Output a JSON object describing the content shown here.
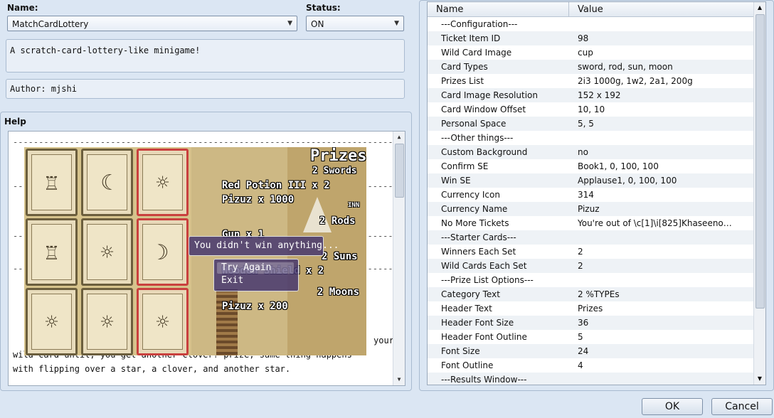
{
  "plugin": {
    "name_label": "Name:",
    "name_value": "MatchCardLottery",
    "status_label": "Status:",
    "status_value": "ON",
    "description": "A scratch-card-lottery-like minigame!",
    "author": "Author: mjshi"
  },
  "help": {
    "title": "Help",
    "text_lines": [
      "your",
      "wild card until, you get another clover? prize, same thing happens",
      "with flipping over a star, a clover, and another star."
    ],
    "game": {
      "prizes_title": "Prizes",
      "prizes": [
        "2 Swords",
        "Red Potion III x 2",
        "Pizuz x 1000",
        "2 Rods",
        "Gun x 1",
        "2 Suns",
        "Wooden Shield x 2",
        "2 Moons",
        "Pizuz x 200"
      ],
      "inn_sign": "INN",
      "message": "You didn't win anything...",
      "choices": [
        "Try Again",
        "Exit"
      ]
    }
  },
  "table": {
    "col_name": "Name",
    "col_value": "Value",
    "rows": [
      {
        "name": "---Configuration---",
        "value": ""
      },
      {
        "name": "Ticket Item ID",
        "value": "98"
      },
      {
        "name": "Wild Card Image",
        "value": "cup"
      },
      {
        "name": "Card Types",
        "value": "sword, rod, sun, moon"
      },
      {
        "name": "Prizes List",
        "value": "2i3 1000g, 1w2, 2a1, 200g"
      },
      {
        "name": "Card Image Resolution",
        "value": "152 x 192"
      },
      {
        "name": "Card Window Offset",
        "value": "10, 10"
      },
      {
        "name": "Personal Space",
        "value": "5, 5"
      },
      {
        "name": "---Other things---",
        "value": ""
      },
      {
        "name": "Custom Background",
        "value": "no"
      },
      {
        "name": "Confirm SE",
        "value": "Book1, 0, 100, 100"
      },
      {
        "name": "Win SE",
        "value": "Applause1, 0, 100, 100"
      },
      {
        "name": "Currency Icon",
        "value": "314"
      },
      {
        "name": "Currency Name",
        "value": "Pizuz"
      },
      {
        "name": "No More Tickets",
        "value": "You're out of \\c[1]\\i[825]Khaseeno…"
      },
      {
        "name": "---Starter Cards---",
        "value": ""
      },
      {
        "name": "Winners Each Set",
        "value": "2"
      },
      {
        "name": "Wild Cards Each Set",
        "value": "2"
      },
      {
        "name": "---Prize List Options---",
        "value": ""
      },
      {
        "name": "Category Text",
        "value": "2 %TYPEs"
      },
      {
        "name": "Header Text",
        "value": "Prizes"
      },
      {
        "name": "Header Font Size",
        "value": "36"
      },
      {
        "name": "Header Font Outline",
        "value": "5"
      },
      {
        "name": "Font Size",
        "value": "24"
      },
      {
        "name": "Font Outline",
        "value": "4"
      },
      {
        "name": "---Results Window---",
        "value": ""
      }
    ]
  },
  "buttons": {
    "ok": "OK",
    "cancel": "Cancel"
  }
}
